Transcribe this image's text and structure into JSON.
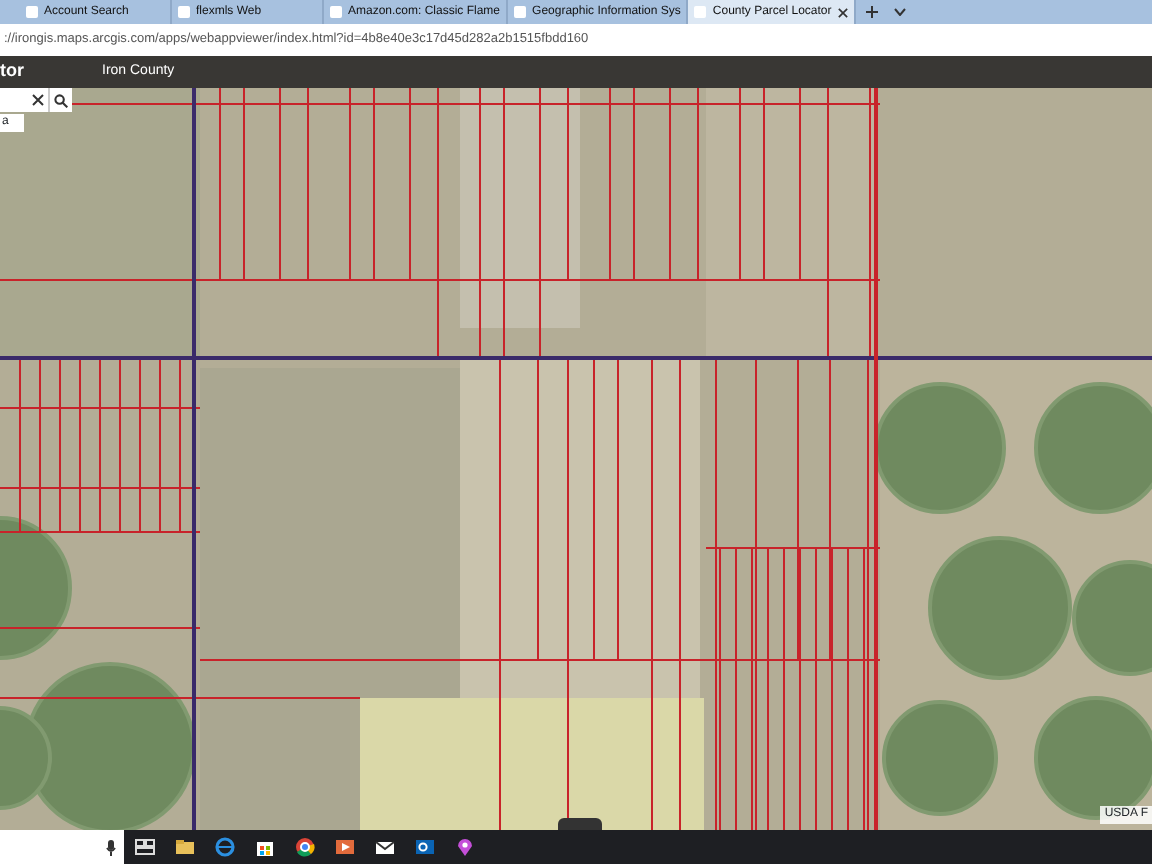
{
  "browser": {
    "tabs": [
      {
        "title": "Account Search",
        "selected": false
      },
      {
        "title": "flexmls Web",
        "selected": false
      },
      {
        "title": "Amazon.com: Classic Flame",
        "selected": false
      },
      {
        "title": "Geographic Information Sys",
        "selected": false
      },
      {
        "title": "County Parcel Locator",
        "selected": true
      }
    ],
    "address": "://irongis.maps.arcgis.com/apps/webappviewer/index.html?id=4b8e40e3c17d45d282a2b1515fbdd160"
  },
  "app_header": {
    "title": "tor",
    "subtitle": "Iron County"
  },
  "search": {
    "result": "a"
  },
  "map": {
    "attribution": "USDA F"
  }
}
